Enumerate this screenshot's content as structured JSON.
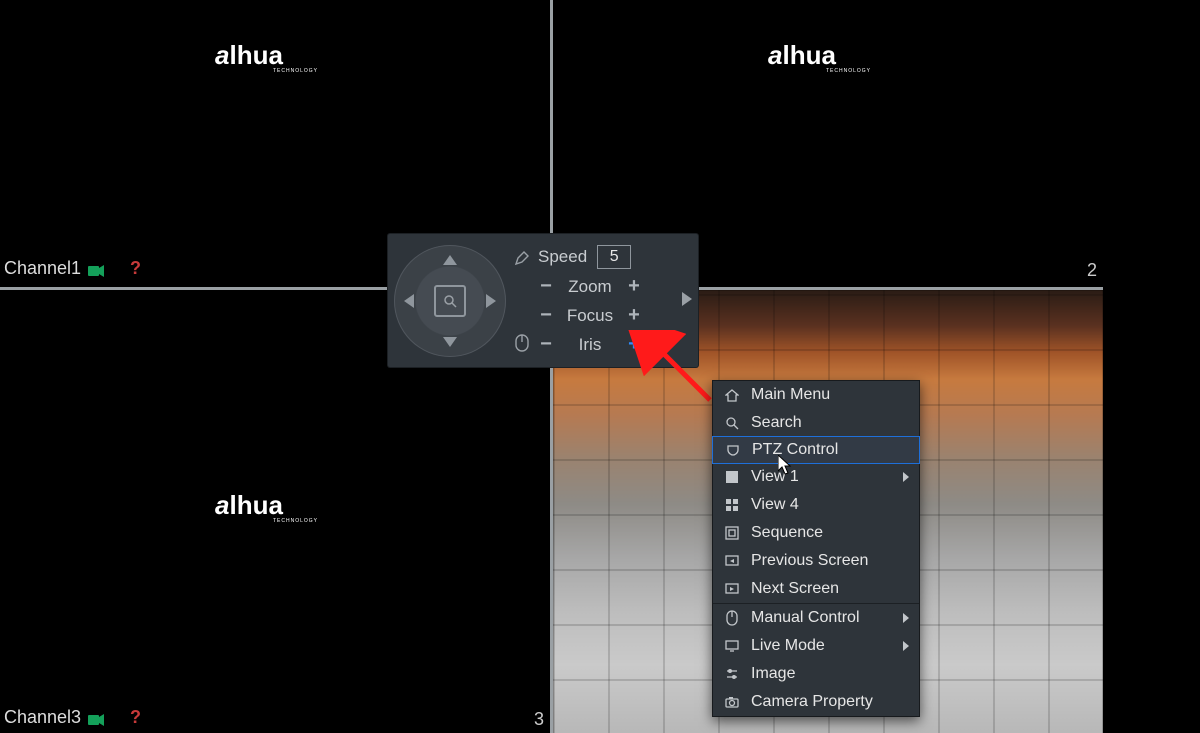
{
  "brand": "alhua",
  "brand_sub": "TECHNOLOGY",
  "panes": {
    "tl": {
      "channel_label": "Channel1",
      "qmark": "?",
      "chnum": ""
    },
    "tr": {
      "channel_label": "",
      "qmark": "",
      "chnum": "2"
    },
    "bl": {
      "channel_label": "Channel3",
      "qmark": "?",
      "chnum": "3"
    },
    "br": {
      "channel_label": "",
      "qmark": "",
      "chnum": ""
    }
  },
  "ptz": {
    "speed_label": "Speed",
    "speed_value": "5",
    "zoom_label": "Zoom",
    "focus_label": "Focus",
    "iris_label": "Iris",
    "minus": "−",
    "plus": "+"
  },
  "context_menu": {
    "main_menu": "Main Menu",
    "search": "Search",
    "ptz_control": "PTZ Control",
    "view1": "View 1",
    "view4": "View 4",
    "sequence": "Sequence",
    "previous_screen": "Previous Screen",
    "next_screen": "Next Screen",
    "manual_control": "Manual Control",
    "live_mode": "Live Mode",
    "image": "Image",
    "camera_property": "Camera Property"
  }
}
